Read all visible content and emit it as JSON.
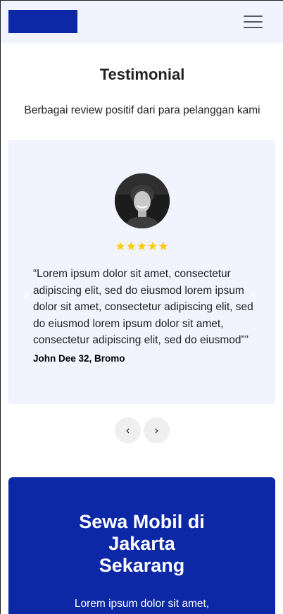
{
  "header": {
    "logo_color": "#0d28a6",
    "menu_icon": "hamburger-menu-icon"
  },
  "testimonial": {
    "title": "Testimonial",
    "subtitle": "Berbagai review positif dari para pelanggan kami",
    "card_background": "#f1f3ff",
    "rating": 5,
    "stars": "★★★★★",
    "quote": "“Lorem ipsum dolor sit amet, consectetur adipiscing elit, sed do eiusmod lorem ipsum dolor sit amet, consectetur adipiscing elit, sed do eiusmod lorem ipsum dolor sit amet, consectetur adipiscing elit, sed do eiusmod””",
    "reviewer": "John Dee 32, Bromo",
    "ghost_prev_glyph": "‹",
    "ghost_next_glyph": "›",
    "prev_label": "‹",
    "next_label": "›"
  },
  "cta": {
    "background": "#0d28a6",
    "title_line1": "Sewa Mobil di",
    "title_line2": "Jakarta",
    "title_line3": "Sekarang",
    "text": "Lorem ipsum dolor sit amet,"
  },
  "colors": {
    "star": "#f9cc00",
    "nav_button": "#efefef"
  }
}
